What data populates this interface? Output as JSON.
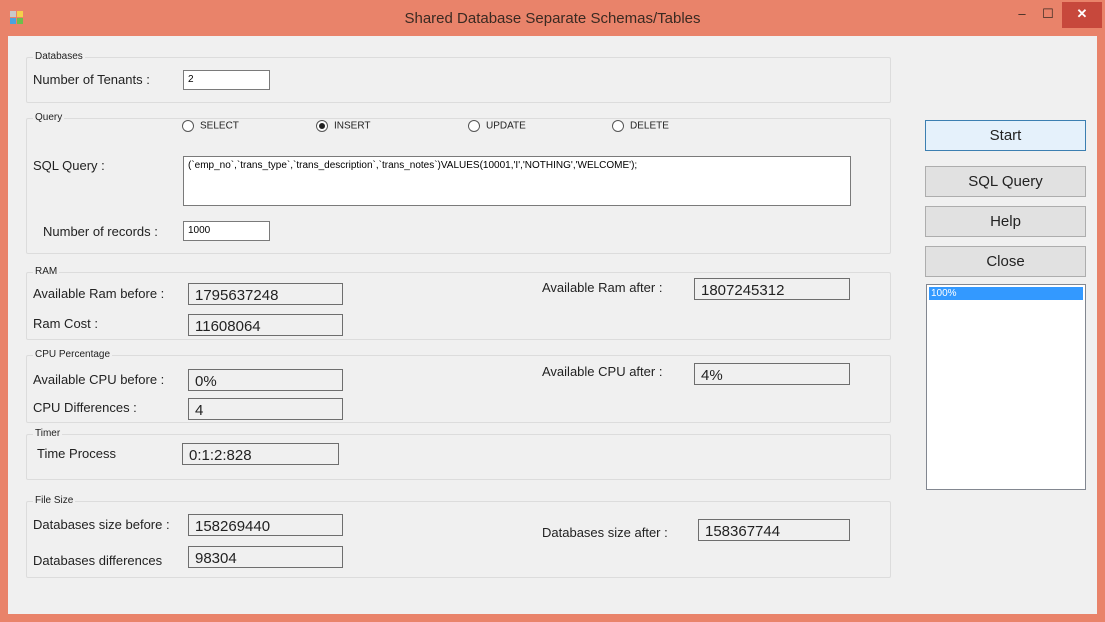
{
  "window": {
    "title": "Shared Database Separate Schemas/Tables",
    "accent": "#e9836a",
    "controls": {
      "minimize": "–",
      "maximize": "☐",
      "close": "✕"
    }
  },
  "databases": {
    "legend": "Databases",
    "tenants_label": "Number of Tenants  :",
    "tenants_value": "2"
  },
  "query": {
    "legend": "Query",
    "radios": [
      {
        "label": "SELECT",
        "checked": false
      },
      {
        "label": "INSERT",
        "checked": true
      },
      {
        "label": "UPDATE",
        "checked": false
      },
      {
        "label": "DELETE",
        "checked": false
      }
    ],
    "sql_label": "SQL Query  :",
    "sql_value": "(`emp_no`,`trans_type`,`trans_description`,`trans_notes`)VALUES(10001,'I','NOTHING','WELCOME');",
    "records_label": "Number of records :",
    "records_value": "1000"
  },
  "ram": {
    "legend": "RAM",
    "before_label": "Available Ram before :",
    "before_value": "1795637248",
    "after_label": "Available Ram after :",
    "after_value": "1807245312",
    "cost_label": "Ram Cost :",
    "cost_value": "11608064"
  },
  "cpu": {
    "legend": "CPU Percentage",
    "before_label": "Available CPU  before :",
    "before_value": "0%",
    "after_label": "Available CPU after :",
    "after_value": "4%",
    "diff_label": "CPU Differences :",
    "diff_value": "4"
  },
  "timer": {
    "legend": "Timer",
    "label": "Time Process",
    "value": "0:1:2:828"
  },
  "filesize": {
    "legend": "File Size",
    "before_label": "Databases size before :",
    "before_value": "158269440",
    "after_label": "Databases size after :",
    "after_value": "158367744",
    "diff_label": "Databases differences",
    "diff_value": "98304"
  },
  "buttons": {
    "start": "Start",
    "sql_query": "SQL Query",
    "help": "Help",
    "close": "Close"
  },
  "progress_list": [
    "100%"
  ]
}
